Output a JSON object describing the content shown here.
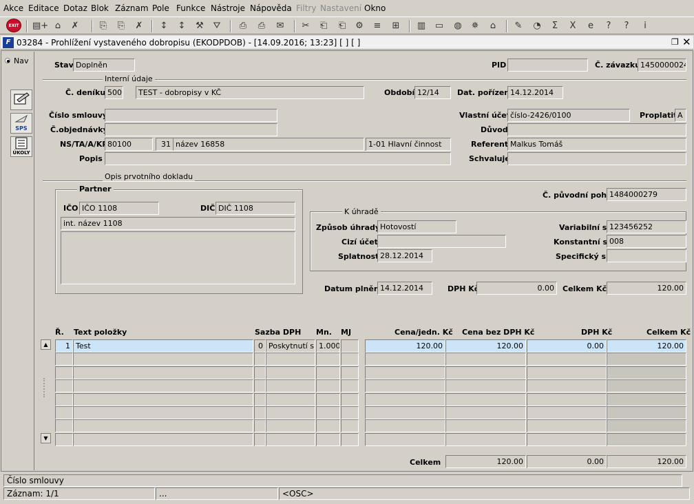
{
  "menu": [
    "Akce",
    "Editace",
    "Dotaz",
    "Blok",
    "Záznam",
    "Pole",
    "Funkce",
    "Nástroje",
    "Nápověda",
    "Filtry",
    "Nastavení",
    "Okno"
  ],
  "menu_disabled": [
    "Filtry",
    "Nastavení"
  ],
  "toolbar": {
    "exit_label": "EXIT"
  },
  "window": {
    "title": "03284 - Prohlížení vystaveného dobropisu (EKODPDOB) - [14.09.2016; 13:23]  [ ]  [ ]",
    "app_icon": "F"
  },
  "left_panel": {
    "nav_label": "Nav",
    "sps_label": "SPS",
    "ukoly_label": "ÚKOLY"
  },
  "header": {
    "stav_label": "Stav",
    "stav": "Doplněn",
    "pid_label": "PID",
    "pid": "",
    "zavazek_label": "Č. závazku",
    "zavazek": "1450000024"
  },
  "interni": {
    "title": "Interní údaje",
    "denik_label": "Č. deníku",
    "denik": "500",
    "denik_nazev": "TEST - dobropisy v KČ",
    "obdobi_label": "Období",
    "obdobi": "12/14",
    "porizeni_label": "Dat. pořízení",
    "porizeni": "14.12.2014",
    "smlouva_label": "Číslo smlouvy",
    "smlouva": "",
    "objednavka_label": "Č.objednávky",
    "objednavka": "",
    "nsta_label": "NS/TA/A/KP",
    "ns": "80100",
    "ta": "31",
    "a": "název 16858",
    "kp": "1-01 Hlavní činnost",
    "popis_label": "Popis",
    "popis": "",
    "ucet_label": "Vlastní účet",
    "ucet": "číslo-2426/0100",
    "proplatit_label": "Proplatit",
    "proplatit": "A",
    "duvod_label": "Důvod",
    "duvod": "",
    "referent_label": "Referent",
    "referent": "Malkus Tomáš",
    "schvaluje_label": "Schvaluje",
    "schvaluje": ""
  },
  "opis": {
    "title": "Opis prvotního dokladu",
    "partner_title": "Partner",
    "ico_label": "IČO",
    "ico": "IČO 1108",
    "dic_label": "DIČ",
    "dic": "DIČ 1108",
    "nazev": "int. název 1108",
    "puvodni_label": "Č. původní pohl.",
    "puvodni": "1484000279",
    "uhrade_title": "K úhradě",
    "zpusob_label": "Způsob úhrady",
    "zpusob": "Hotovostí",
    "cizi_label": "Cizí účet",
    "cizi": "",
    "splatnost_label": "Splatnost",
    "splatnost": "28.12.2014",
    "vs_label": "Variabilní s.",
    "vs": "123456252",
    "ks_label": "Konstantní s.",
    "ks": "008",
    "ss_label": "Specifický s.",
    "ss": "",
    "plneni_label": "Datum plnění",
    "plneni": "14.12.2014",
    "dph_label": "DPH Kč",
    "dph": "0.00",
    "celkem_label": "Celkem Kč",
    "celkem": "120.00"
  },
  "items": {
    "headers": [
      "Ř.",
      "Text položky",
      "Sazba DPH",
      "Mn.",
      "MJ",
      "Cena/jedn. Kč",
      "Cena bez DPH Kč",
      "DPH Kč",
      "Celkem Kč"
    ],
    "rows": [
      {
        "r": "1",
        "text": "Test",
        "sazba": "0",
        "sazba_text": "Poskytnutí slu",
        "mn": "1.000",
        "mj": "",
        "cena": "120.00",
        "bezdph": "120.00",
        "dph": "0.00",
        "celkem": "120.00"
      }
    ],
    "total_label": "Celkem",
    "total_bezdph": "120.00",
    "total_dph": "0.00",
    "total_celkem": "120.00"
  },
  "status": {
    "field": "Číslo smlouvy",
    "record": "Záznam: 1/1",
    "dots": "...",
    "mode": "<OSC>"
  }
}
